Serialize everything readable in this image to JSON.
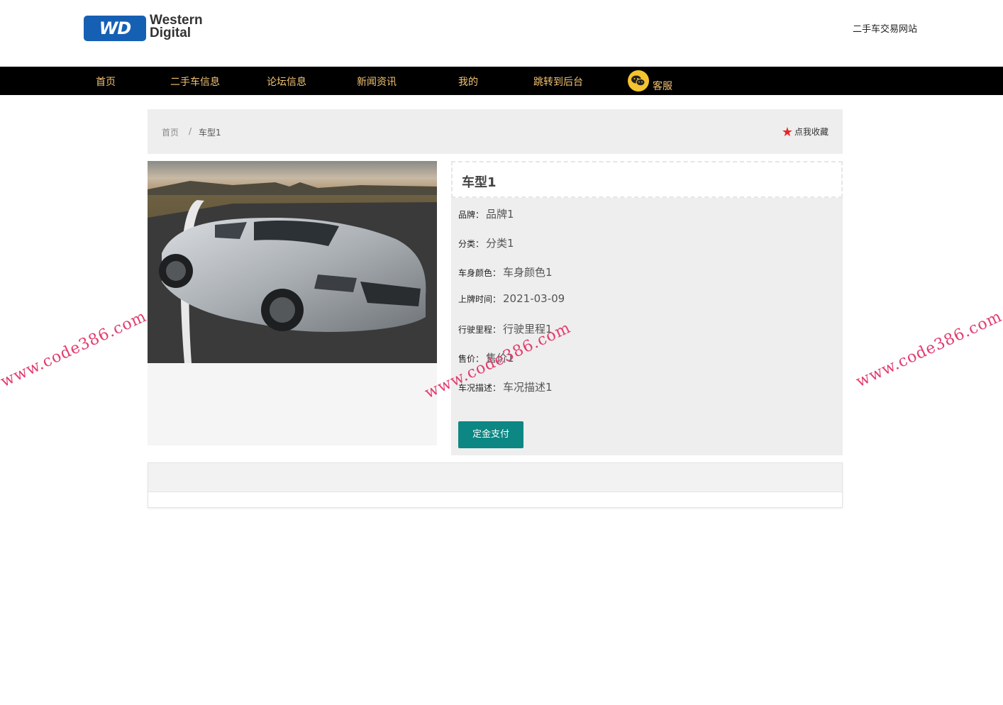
{
  "header": {
    "logo": {
      "badge": "WD",
      "line1": "Western",
      "line2": "Digital"
    },
    "site_title": "二手车交易网站"
  },
  "nav": {
    "items": [
      "首页",
      "二手车信息",
      "论坛信息",
      "新闻资讯",
      "我的",
      "跳转到后台"
    ],
    "service_label": "客服",
    "text_color": "#f3c372"
  },
  "breadcrumb": {
    "home": "首页",
    "separator": "/",
    "current": "车型1"
  },
  "favorite": {
    "label": "点我收藏",
    "star": "★"
  },
  "detail": {
    "title": "车型1",
    "fields": [
      {
        "label": "品牌：",
        "value": "品牌1"
      },
      {
        "label": "分类：",
        "value": "分类1"
      },
      {
        "label": "车身颜色：",
        "value": "车身颜色1"
      },
      {
        "label": "上牌时间：",
        "value": "2021-03-09"
      },
      {
        "label": "行驶里程：",
        "value": "行驶里程1"
      },
      {
        "label": "售价：",
        "value": "售价1"
      },
      {
        "label": "车况描述：",
        "value": "车况描述1"
      }
    ],
    "pay_button": "定金支付"
  },
  "watermark": "www.code386.com",
  "colors": {
    "nav_bg": "#000000",
    "accent_button": "#0c8783",
    "star": "#e82525"
  }
}
